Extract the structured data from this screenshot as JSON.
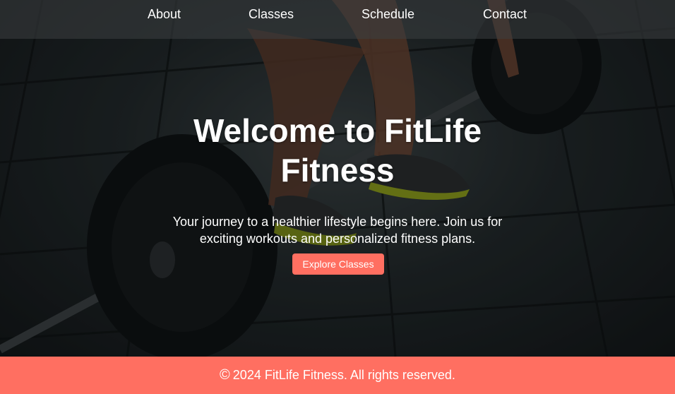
{
  "nav": {
    "items": [
      {
        "label": "About"
      },
      {
        "label": "Classes"
      },
      {
        "label": "Schedule"
      },
      {
        "label": "Contact"
      }
    ]
  },
  "hero": {
    "title": "Welcome to FitLife Fitness",
    "subtitle": "Your journey to a healthier lifestyle begins here. Join us for exciting workouts and personalized fitness plans.",
    "cta_label": "Explore Classes",
    "background_description_icon": "barbell-deadlift-photo"
  },
  "footer": {
    "copyright_symbol": "©",
    "text": "2024 FitLife Fitness. All rights reserved."
  },
  "colors": {
    "accent": "#ff6f61",
    "nav_bg": "#3c4042",
    "text": "#ffffff"
  }
}
